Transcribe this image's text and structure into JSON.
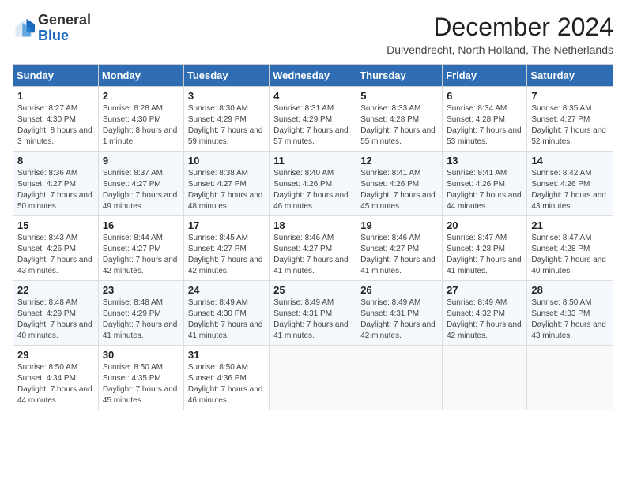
{
  "logo": {
    "general": "General",
    "blue": "Blue"
  },
  "header": {
    "title": "December 2024",
    "location": "Duivendrecht, North Holland, The Netherlands"
  },
  "days_of_week": [
    "Sunday",
    "Monday",
    "Tuesday",
    "Wednesday",
    "Thursday",
    "Friday",
    "Saturday"
  ],
  "weeks": [
    [
      {
        "day": 1,
        "sunrise": "Sunrise: 8:27 AM",
        "sunset": "Sunset: 4:30 PM",
        "daylight": "Daylight: 8 hours and 3 minutes."
      },
      {
        "day": 2,
        "sunrise": "Sunrise: 8:28 AM",
        "sunset": "Sunset: 4:30 PM",
        "daylight": "Daylight: 8 hours and 1 minute."
      },
      {
        "day": 3,
        "sunrise": "Sunrise: 8:30 AM",
        "sunset": "Sunset: 4:29 PM",
        "daylight": "Daylight: 7 hours and 59 minutes."
      },
      {
        "day": 4,
        "sunrise": "Sunrise: 8:31 AM",
        "sunset": "Sunset: 4:29 PM",
        "daylight": "Daylight: 7 hours and 57 minutes."
      },
      {
        "day": 5,
        "sunrise": "Sunrise: 8:33 AM",
        "sunset": "Sunset: 4:28 PM",
        "daylight": "Daylight: 7 hours and 55 minutes."
      },
      {
        "day": 6,
        "sunrise": "Sunrise: 8:34 AM",
        "sunset": "Sunset: 4:28 PM",
        "daylight": "Daylight: 7 hours and 53 minutes."
      },
      {
        "day": 7,
        "sunrise": "Sunrise: 8:35 AM",
        "sunset": "Sunset: 4:27 PM",
        "daylight": "Daylight: 7 hours and 52 minutes."
      }
    ],
    [
      {
        "day": 8,
        "sunrise": "Sunrise: 8:36 AM",
        "sunset": "Sunset: 4:27 PM",
        "daylight": "Daylight: 7 hours and 50 minutes."
      },
      {
        "day": 9,
        "sunrise": "Sunrise: 8:37 AM",
        "sunset": "Sunset: 4:27 PM",
        "daylight": "Daylight: 7 hours and 49 minutes."
      },
      {
        "day": 10,
        "sunrise": "Sunrise: 8:38 AM",
        "sunset": "Sunset: 4:27 PM",
        "daylight": "Daylight: 7 hours and 48 minutes."
      },
      {
        "day": 11,
        "sunrise": "Sunrise: 8:40 AM",
        "sunset": "Sunset: 4:26 PM",
        "daylight": "Daylight: 7 hours and 46 minutes."
      },
      {
        "day": 12,
        "sunrise": "Sunrise: 8:41 AM",
        "sunset": "Sunset: 4:26 PM",
        "daylight": "Daylight: 7 hours and 45 minutes."
      },
      {
        "day": 13,
        "sunrise": "Sunrise: 8:41 AM",
        "sunset": "Sunset: 4:26 PM",
        "daylight": "Daylight: 7 hours and 44 minutes."
      },
      {
        "day": 14,
        "sunrise": "Sunrise: 8:42 AM",
        "sunset": "Sunset: 4:26 PM",
        "daylight": "Daylight: 7 hours and 43 minutes."
      }
    ],
    [
      {
        "day": 15,
        "sunrise": "Sunrise: 8:43 AM",
        "sunset": "Sunset: 4:26 PM",
        "daylight": "Daylight: 7 hours and 43 minutes."
      },
      {
        "day": 16,
        "sunrise": "Sunrise: 8:44 AM",
        "sunset": "Sunset: 4:27 PM",
        "daylight": "Daylight: 7 hours and 42 minutes."
      },
      {
        "day": 17,
        "sunrise": "Sunrise: 8:45 AM",
        "sunset": "Sunset: 4:27 PM",
        "daylight": "Daylight: 7 hours and 42 minutes."
      },
      {
        "day": 18,
        "sunrise": "Sunrise: 8:46 AM",
        "sunset": "Sunset: 4:27 PM",
        "daylight": "Daylight: 7 hours and 41 minutes."
      },
      {
        "day": 19,
        "sunrise": "Sunrise: 8:46 AM",
        "sunset": "Sunset: 4:27 PM",
        "daylight": "Daylight: 7 hours and 41 minutes."
      },
      {
        "day": 20,
        "sunrise": "Sunrise: 8:47 AM",
        "sunset": "Sunset: 4:28 PM",
        "daylight": "Daylight: 7 hours and 41 minutes."
      },
      {
        "day": 21,
        "sunrise": "Sunrise: 8:47 AM",
        "sunset": "Sunset: 4:28 PM",
        "daylight": "Daylight: 7 hours and 40 minutes."
      }
    ],
    [
      {
        "day": 22,
        "sunrise": "Sunrise: 8:48 AM",
        "sunset": "Sunset: 4:29 PM",
        "daylight": "Daylight: 7 hours and 40 minutes."
      },
      {
        "day": 23,
        "sunrise": "Sunrise: 8:48 AM",
        "sunset": "Sunset: 4:29 PM",
        "daylight": "Daylight: 7 hours and 41 minutes."
      },
      {
        "day": 24,
        "sunrise": "Sunrise: 8:49 AM",
        "sunset": "Sunset: 4:30 PM",
        "daylight": "Daylight: 7 hours and 41 minutes."
      },
      {
        "day": 25,
        "sunrise": "Sunrise: 8:49 AM",
        "sunset": "Sunset: 4:31 PM",
        "daylight": "Daylight: 7 hours and 41 minutes."
      },
      {
        "day": 26,
        "sunrise": "Sunrise: 8:49 AM",
        "sunset": "Sunset: 4:31 PM",
        "daylight": "Daylight: 7 hours and 42 minutes."
      },
      {
        "day": 27,
        "sunrise": "Sunrise: 8:49 AM",
        "sunset": "Sunset: 4:32 PM",
        "daylight": "Daylight: 7 hours and 42 minutes."
      },
      {
        "day": 28,
        "sunrise": "Sunrise: 8:50 AM",
        "sunset": "Sunset: 4:33 PM",
        "daylight": "Daylight: 7 hours and 43 minutes."
      }
    ],
    [
      {
        "day": 29,
        "sunrise": "Sunrise: 8:50 AM",
        "sunset": "Sunset: 4:34 PM",
        "daylight": "Daylight: 7 hours and 44 minutes."
      },
      {
        "day": 30,
        "sunrise": "Sunrise: 8:50 AM",
        "sunset": "Sunset: 4:35 PM",
        "daylight": "Daylight: 7 hours and 45 minutes."
      },
      {
        "day": 31,
        "sunrise": "Sunrise: 8:50 AM",
        "sunset": "Sunset: 4:36 PM",
        "daylight": "Daylight: 7 hours and 46 minutes."
      },
      null,
      null,
      null,
      null
    ]
  ]
}
